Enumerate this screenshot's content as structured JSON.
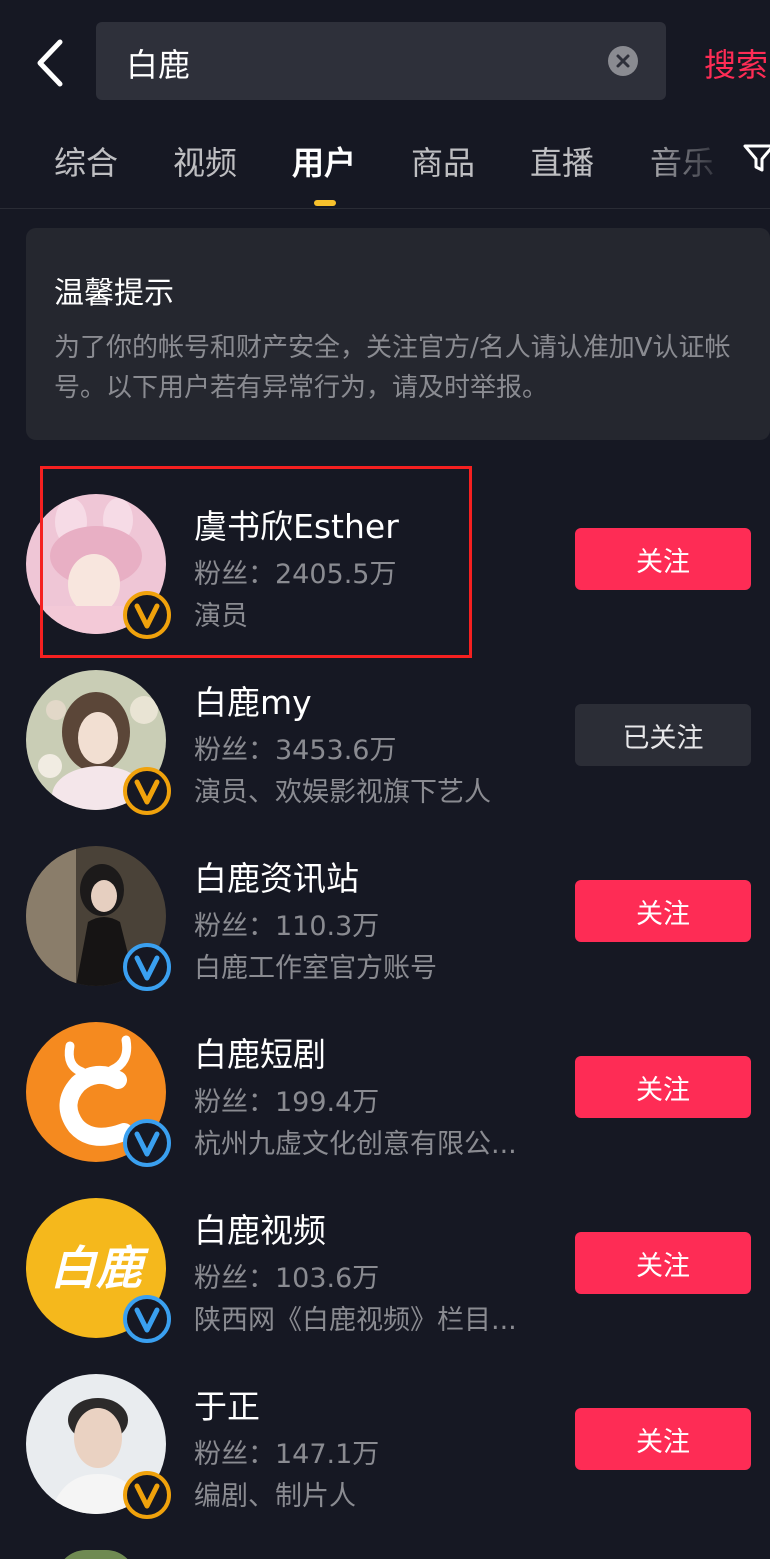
{
  "search": {
    "query": "白鹿",
    "action_label": "搜索"
  },
  "tabs": [
    {
      "label": "综合",
      "active": false
    },
    {
      "label": "视频",
      "active": false
    },
    {
      "label": "用户",
      "active": true
    },
    {
      "label": "商品",
      "active": false
    },
    {
      "label": "直播",
      "active": false
    },
    {
      "label": "音乐",
      "active": false
    }
  ],
  "notice": {
    "title": "温馨提示",
    "body": "为了你的帐号和财产安全，关注官方/名人请认准加V认证帐号。以下用户若有异常行为，请及时举报。"
  },
  "users": [
    {
      "name": "虞书欣Esther",
      "fans": "粉丝：2405.5万",
      "desc": "演员",
      "follow_label": "关注",
      "followed": false,
      "badge_color": "#f0a20c",
      "avatar_theme": "pink"
    },
    {
      "name": "白鹿my",
      "fans": "粉丝：3453.6万",
      "desc": "演员、欢娱影视旗下艺人",
      "follow_label": "已关注",
      "followed": true,
      "badge_color": "#f0a20c",
      "avatar_theme": "floral"
    },
    {
      "name": "白鹿资讯站",
      "fans": "粉丝：110.3万",
      "desc": "白鹿工作室官方账号",
      "follow_label": "关注",
      "followed": false,
      "badge_color": "#3aa0f0",
      "avatar_theme": "dark"
    },
    {
      "name": "白鹿短剧",
      "fans": "粉丝：199.4万",
      "desc": "杭州九虚文化创意有限公...",
      "follow_label": "关注",
      "followed": false,
      "badge_color": "#3aa0f0",
      "avatar_theme": "orange-logo"
    },
    {
      "name": "白鹿视频",
      "fans": "粉丝：103.6万",
      "desc": "陕西网《白鹿视频》栏目...",
      "follow_label": "关注",
      "followed": false,
      "badge_color": "#3aa0f0",
      "avatar_theme": "yellow-logo",
      "avatar_logo_text": "白鹿"
    },
    {
      "name": "于正",
      "fans": "粉丝：147.1万",
      "desc": "编剧、制片人",
      "follow_label": "关注",
      "followed": false,
      "badge_color": "#f0a20c",
      "avatar_theme": "portrait"
    }
  ],
  "colors": {
    "background": "#161823",
    "accent": "#fe2c55",
    "tab_indicator": "#f8c12c",
    "highlight_box": "#f52020"
  }
}
